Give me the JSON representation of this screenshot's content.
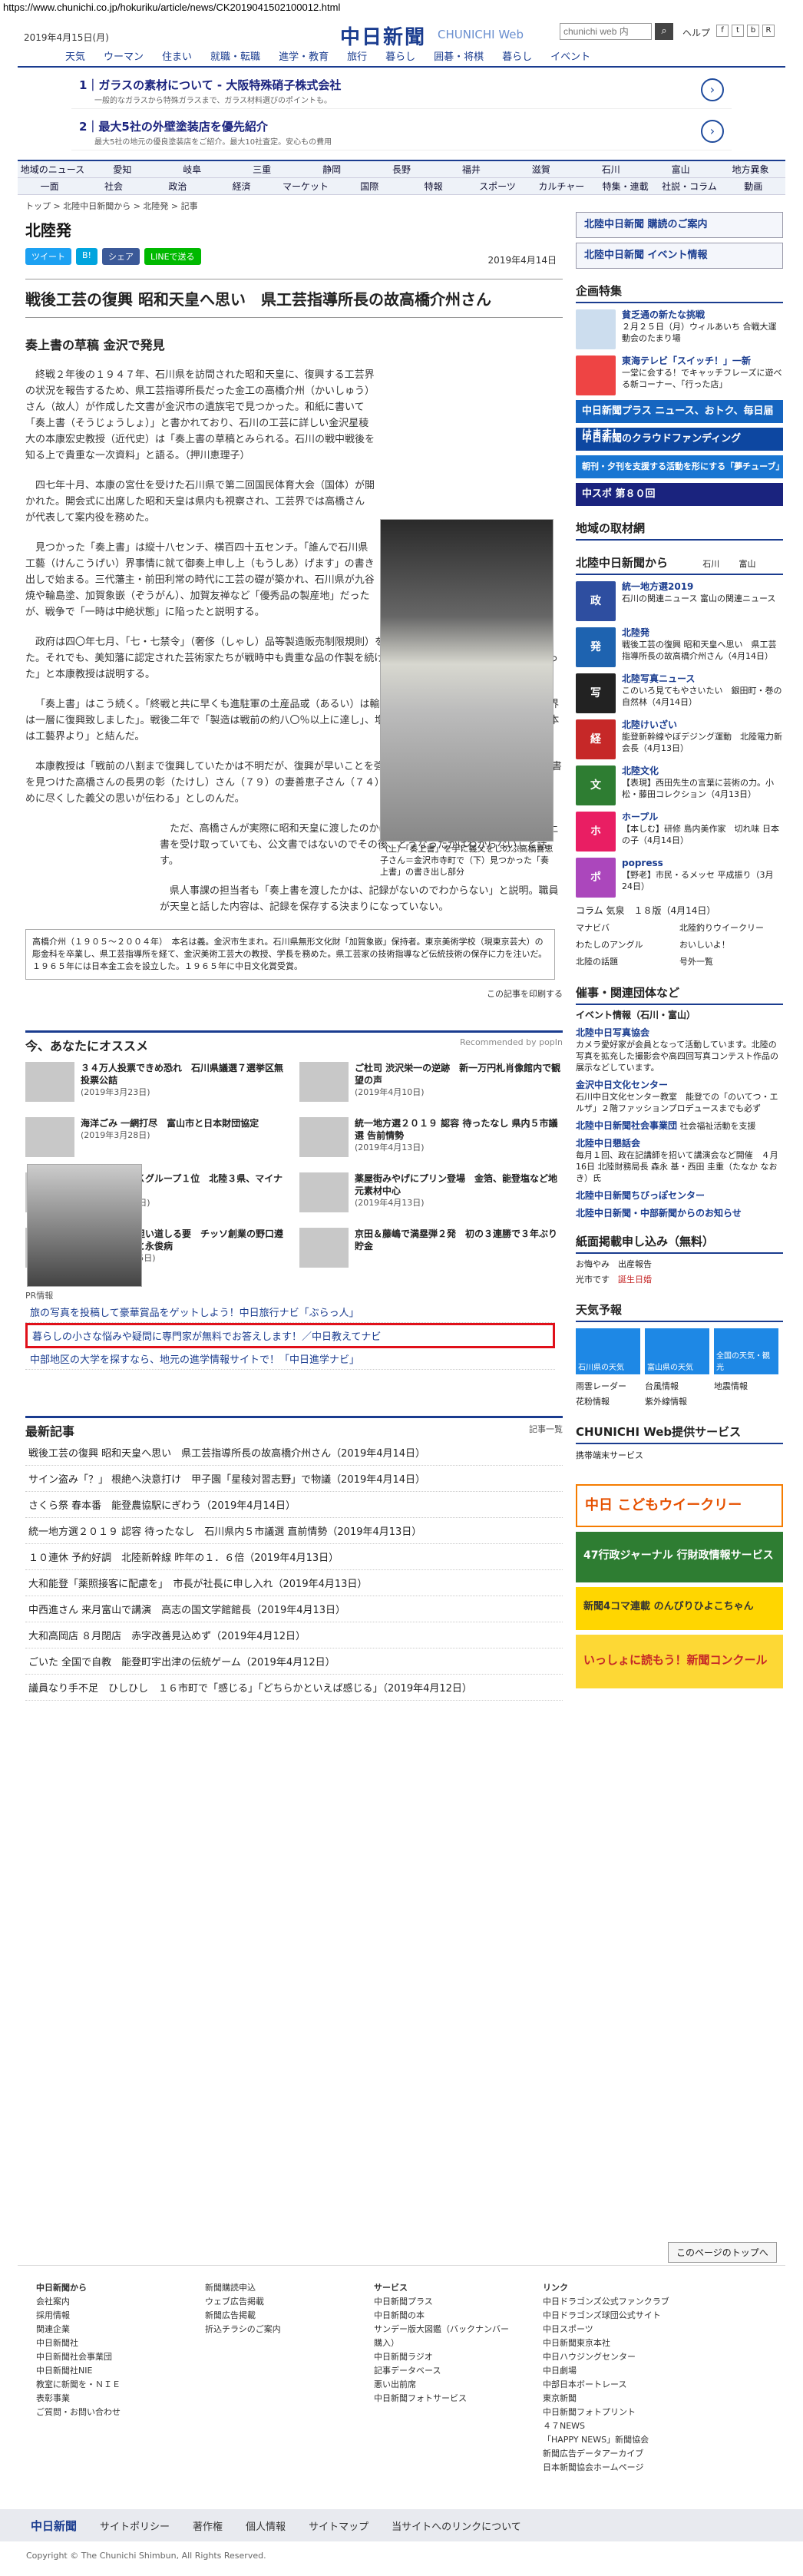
{
  "url": "https://www.chunichi.co.jp/hokuriku/article/news/CK2019041502100012.html",
  "topbar": {
    "date": "2019年4月15日(月)",
    "logo": "中日新聞",
    "logo_sub": "CHUNICHI Web",
    "search_placeholder": "chunichi web 内",
    "links": [
      "天気",
      "ウーマン",
      "住まい",
      "就職・転職",
      "進学・教育",
      "旅行",
      "暮らし",
      "囲碁・将棋",
      "暮らし",
      "イベント"
    ],
    "right": "ヘルプ",
    "icons": [
      "sq-a",
      "sq-b",
      "sq-c",
      "sq-d"
    ]
  },
  "ads": [
    {
      "title": "1｜ガラスの素材について - 大阪特殊硝子株式会社",
      "sub": "一般的なガラスから特殊ガラスまで、ガラス材料選びのポイントも。"
    },
    {
      "title": "2｜最大5社の外壁塗装店を優先紹介",
      "sub": "最大5社の地元の優良塗装店をご紹介。最大10社査定。安心もの費用"
    }
  ],
  "catrow1": [
    "地域のニュース",
    "愛知",
    "岐阜",
    "三重",
    "静岡",
    "長野",
    "福井",
    "滋賀",
    "石川",
    "富山",
    "地方異象"
  ],
  "catrow2": [
    "一面",
    "社会",
    "政治",
    "経済",
    "マーケット",
    "国際",
    "特報",
    "スポーツ",
    "カルチャー",
    "特集・連載",
    "社説・コラム",
    "動画"
  ],
  "breadcrumb": "トップ > 北陸中日新聞から > 北陸発 > 記事",
  "section": "北陸発",
  "share": {
    "tw": "ツイート",
    "hb": "B!",
    "fb": "シェア",
    "ln": "LINEで送る",
    "date": "2019年4月14日"
  },
  "headline": "戦後工芸の復興 昭和天皇へ思い　県工芸指導所長の故高橋介州さん",
  "subhead": "奏上書の草稿 金沢で発見",
  "paragraphs": [
    "終戦２年後の１９４７年、石川県を訪問された昭和天皇に、復興する工芸界の状況を報告するため、県工芸指導所長だった金工の高橋介州（かいしゅう）さん（故人）が作成した文書が金沢市の遺族宅で見つかった。和紙に書いて「奏上書（そうじょうしょ）」と書かれており、石川の工芸に詳しい金沢星稜大の本康宏史教授（近代史）は「奏上書の草稿とみられる。石川の戦中戦後を知る上で貴重な一次資料」と語る。（押川恵理子）",
    "四七年十月、本康の宮仕を受けた石川県で第二回国民体育大会（国体）が開かれた。開会式に出席した昭和天皇は県内も視察され、工芸界では高橋さんが代表して案内役を務めた。",
    "見つかった「奏上書」は縦十八センチ、横百四十五センチ。「誰んで石川県工藝（けんこうげい）界事情に就て御奏上申し上（もうしあ）げます」の書き出しで始まる。三代藩主・前田利常の時代に工芸の礎が築かれ、石川県が九谷焼や輪島塗、加賀象嵌（ぞうがん）、加賀友禅など「優秀品の製産地」だったが、戦争で「一時は中絶状態」に陥ったと説明する。",
    "政府は四〇年七月、「七・七禁令」（奢侈（しゃし）品等製造販売制限規則）を出し、ぜいたく品の製造・販売を禁じた。それでも、美知藩に認定された芸術家たちが戦時中も貴重な品の作製を続けて、「伝統工芸は細い糸ながらつながった」と本康教授は説明する。",
    "「奏上書」はこう続く。「終戦と共に早くも進駐軍の土産品或（あるい）は輸入物資の見返品として取り上げられ業界は一層に復興致しました」。戦後二年で「製造は戦前の約八〇％以上に達し」、増産できる状況にもあるとし、「再建日本は工藝界より」と結んだ。",
    "本康教授は「戦前の八割まで復興していたかは不明だが、復興が早いことを強調したかったのだろう」と話す。奏上書を見つけた高橋さんの長男の彰（たけし）さん（７９）の妻善恵子さん（７４）＝金沢市寺町＝は「工芸界の復興のために尽くした義父の思いが伝わる」としのんだ。",
    "ただ、高橋さんが実際に昭和天皇に渡したのかは定かではない。宮内庁報道係は「奏上書を受け取っていても、公文書ではないのでその後、どうなったかはわからない」と話す。",
    "県人事課の担当者も「奏上書を渡したかは、記録がないのでわからない」と説明。職員が天皇と話した内容は、記録を保存する決まりになっていない。"
  ],
  "caption": "（上）「奏上書」を手に義父をしのぶ高橋喜恵子さん＝金沢市寺町で（下）見つかった「奏上書」の書き出し部分",
  "profile": "高橋介州（１９０５〜２００４年）　本名は義。金沢市生まれ。石川県無形文化財「加賀象嵌」保持者。東京美術学校（現東京芸大）の彫金科を卒業し、県工芸指導所を経て、金沢美術工芸大の教授、学長を務めた。県工芸家の技術指導など伝統技術の保存に力を注いだ。１９６５年には日本金工会を設立した。１９６５年に中日文化賞受賞。",
  "print_label": "この記事を印刷する",
  "recommend": {
    "title": "今、あなたにオススメ",
    "by": "Recommended by popIn",
    "items": [
      {
        "t": "３４万人投票できめ恐れ　石川県議選７選挙区無投票公詰",
        "d": "(2019年3月23日)"
      },
      {
        "t": "ご杜司 渋沢栄一の逆跡　新一万円札肖像館内で観望の声",
        "d": "(2019年4月10日)"
      },
      {
        "t": "海洋ごみ 一網打尽　富山市と日本財団協定",
        "d": "(2019年3月28日)"
      },
      {
        "t": "統一地方選２０１９ 認容 待ったなし 県内５市議選 告前情勢",
        "d": "(2019年4月13日)"
      },
      {
        "t": "就職人気ＹＫＫグループ１位　北陸３県、マイナビ調査",
        "d": "(2019年4月11日)"
      },
      {
        "t": "薬屋街みやげにプリン登場　金箔、能登塩など地元素材中心",
        "d": "(2019年4月13日)"
      },
      {
        "t": "日本の近代化担い道しる要　チッソ創業の野口遵（金沢出身）と永俊病",
        "d": "(2018年12月15日)"
      },
      {
        "t": "京田＆藤嶋で満塁弾２発　初の３連勝で３年ぶり貯金",
        "d": ""
      }
    ]
  },
  "pr": {
    "label": "PR情報",
    "links": [
      "旅の写真を投稿して豪華賞品をゲットしよう！中日旅行ナビ「ぶらっ人」",
      "暮らしの小さな悩みや疑問に専門家が無料でお答えします！／中日教えてナビ",
      "中部地区の大学を探すなら、地元の進学情報サイトで！「中日進学ナビ」"
    ]
  },
  "latest": {
    "title": "最新記事",
    "more": "記事一覧",
    "items": [
      "戦後工芸の復興 昭和天皇へ思い　県工芸指導所長の故高橋介州さん（2019年4月14日）",
      "サイン盗み「？」 根絶へ決意打け　甲子園「星稜対習志野」で物議（2019年4月14日）",
      "さくら祭 春本番　能登農協駅にぎわう（2019年4月14日）",
      "統一地方選２０１９ 認容 待ったなし　石川県内５市議選 直前情勢（2019年4月13日）",
      "１０連休 予約好調　北陸新幹線 昨年の１．６倍（2019年4月13日）",
      "大和能登「薬照接客に配慮を」　市長が社長に申し入れ（2019年4月13日）",
      "中西進さん 来月富山で講演　高志の国文学館館長（2019年4月13日）",
      "大和高岡店 ８月閉店　赤字改善見込めず（2019年4月12日）",
      "ごいた 全国で自教　能登町宇出津の伝統ゲーム（2019年4月12日）",
      "議員なり手不足　ひしひし　１６市町で「感じる」「どちらかといえば感じる」（2019年4月12日）"
    ]
  },
  "side": {
    "box1": "北陸中日新聞 購読のご案内",
    "box2": "北陸中日新聞 イベント情報",
    "special": "企画特集",
    "sp_items": [
      {
        "t": "貧乏通の新たな挑戦",
        "d": "２月２５日（月）ウィルあいち 合戦大運動会のたまり場"
      },
      {
        "t": "東海テレビ「スイッチ！」一新",
        "d": "一堂に会する！でキャッチフレーズに遊べる新コーナー、「行った店」"
      }
    ],
    "banners": [
      "中日新聞プラス ニュース、おトク、毎日届けます！",
      "中日新聞のクラウドファンディング",
      "朝刊・夕刊を支援する活動を形にする「夢チューブ」",
      "中スポ 第８０回"
    ],
    "local": "地域の取材網",
    "news_title": "北陸中日新聞から",
    "news_tabs": [
      "石川",
      "富山"
    ],
    "news_items": [
      {
        "ic": "政",
        "t": "統一地方選2019",
        "d": "石川の関連ニュース 富山の関連ニュース"
      },
      {
        "ic": "発",
        "t": "北陸発",
        "d": "戦後工芸の復興 昭和天皇へ思い　県工芸指導所長の故高橋介州さん（4月14日）"
      },
      {
        "ic": "写",
        "t": "北陸写真ニュース",
        "d": "このいろ見てもやさいたい　銀田町・巻の自然林（4月14日）"
      },
      {
        "ic": "経",
        "t": "北陸けいざい",
        "d": "能登新幹線やぼデジング運動　北陸電力新会長（4月13日）"
      },
      {
        "ic": "文",
        "t": "北陸文化",
        "d": "【表現】西田先生の言葉に芸術の力。小松・藤田コレクション（4月13日）"
      },
      {
        "ic": "ホ",
        "t": "ホープル",
        "d": "【本しむ】研修 島内美作家　切れ味 日本の子（4月14日）"
      },
      {
        "ic": "ポ",
        "t": "popress",
        "d": "【野老】市民・るメッセ 平成振り（3月24日）"
      }
    ],
    "column": "コラム 気泉　１８版（4月14日）",
    "col_links": [
      "マナビバ",
      "北陸釣りウイークリー",
      "わたしのアングル",
      "おいしいよ！",
      "北陸の話題",
      "号外一覧"
    ],
    "biz": "催事・関連団体など",
    "event": "イベント情報（石川・富山）",
    "biz_items": [
      {
        "t": "北陸中日写真協会",
        "d": "カメラ愛好家が会員となって活動しています。北陸の写真を拡充した撮影会や高四回写真コンテスト作品の展示などしています。"
      },
      {
        "t": "金沢中日文化センター",
        "d": "石川中日文化センター教室　能登での「のいてつ・エルザ」２階ファッションプロデュースまでも必ず"
      },
      {
        "t": "北陸中日新聞社会事業団",
        "d": "社会福祉活動を支援"
      },
      {
        "t": "北陸中日懇話会",
        "d": "毎月１回、政在記講師を招いて講演会など開催　４月16日 北陸財務局長 森永 基・西田 圭重（たなか なおき）氏"
      },
      {
        "t": "北陸中日新聞ちびっぽセンター",
        "d": ""
      },
      {
        "t": "北陸中日新聞・中部新聞からのお知らせ",
        "d": ""
      }
    ],
    "ad_title": "紙面掲載申し込み（無料）",
    "ad_links": [
      "お悔やみ",
      "出産報告",
      "光市です",
      "誕生日婚"
    ],
    "weather": "天気予報",
    "w_items": [
      "石川県の天気",
      "富山県の天気",
      "全国の天気・観光"
    ],
    "w_links": [
      "雨雲レーダー",
      "台風情報",
      "地震情報",
      "花粉情報",
      "紫外線情報"
    ],
    "service": "CHUNICHI Web提供サービス",
    "svc_link": "携帯端末サービス",
    "promos": [
      "中日 こどもウイークリー",
      "47行政ジャーナル 行財政情報サービス",
      "新聞4コマ連載 のんびりひよこちゃん",
      "いっしょに読もう！新聞コンクール"
    ]
  },
  "page_top": "このページのトップへ",
  "footer": {
    "cols": [
      {
        "h": "中日新聞から",
        "items": [
          "会社案内",
          "採用情報",
          "関連企業",
          "中日新聞社",
          "中日新聞社会事業団",
          "中日新聞社NIE",
          "教室に新聞を・ＮＩＥ",
          "表彰事業",
          "ご質問・お問い合わせ"
        ]
      },
      {
        "h": "",
        "items": [
          "新聞購読申込",
          "ウェブ広告掲載",
          "新聞広告掲載",
          "折込チラシのご案内"
        ]
      },
      {
        "h": "サービス",
        "items": [
          "中日新聞プラス",
          "中日新聞の本",
          "サンデー版大図鑑（バックナンバー購入）",
          "中日新聞ラジオ",
          "記事データベース",
          "悪い出前席",
          "中日新聞フォトサービス"
        ]
      },
      {
        "h": "リンク",
        "items": [
          "中日ドラゴンズ公式ファンクラブ",
          "中日ドラゴンズ球団公式サイト",
          "中日スポーツ",
          "中日新聞東京本社",
          "中日ハウジングセンター",
          "中日劇場",
          "中部日本ボートレース",
          "東京新聞",
          "中日新聞フォトプリント",
          "４７NEWS",
          "「HAPPY NEWS」新聞協会",
          "新聞広告データアーカイブ",
          "日本新聞協会ホームページ"
        ]
      }
    ],
    "bar": [
      "中日新聞",
      "サイトポリシー",
      "著作権",
      "個人情報",
      "サイトマップ",
      "当サイトへのリンクについて"
    ],
    "copy": "Copyright © The Chunichi Shimbun, All Rights Reserved."
  }
}
